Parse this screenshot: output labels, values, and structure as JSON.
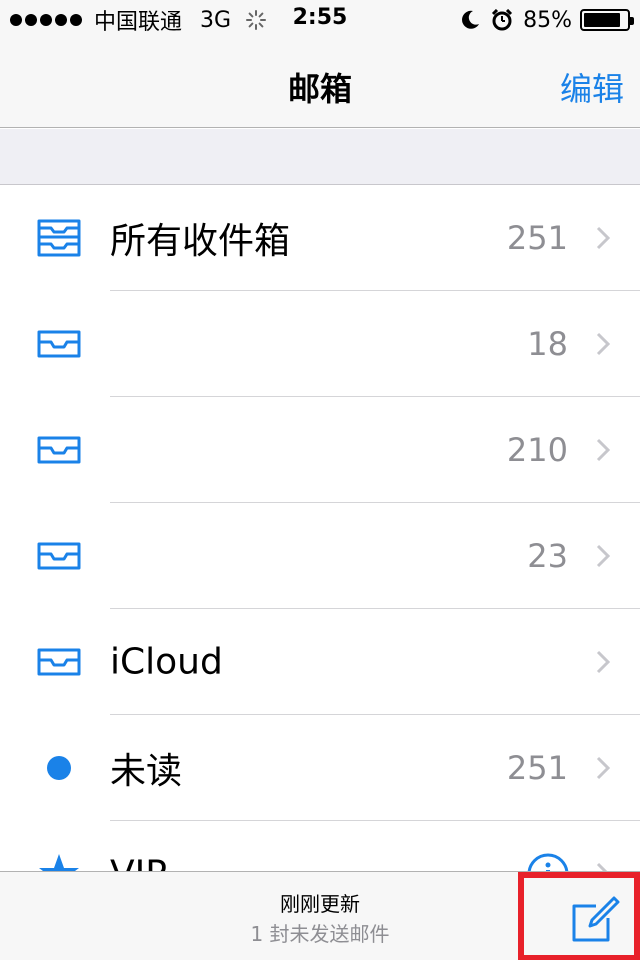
{
  "status_bar": {
    "carrier": "中国联通",
    "network": "3G",
    "time": "2:55",
    "battery": "85%",
    "battery_level": 0.85
  },
  "nav": {
    "title": "邮箱",
    "edit_label": "编辑"
  },
  "mailboxes": [
    {
      "label": "所有收件箱",
      "count": "251",
      "icon": "tray-stack-icon"
    },
    {
      "label": "",
      "count": "18",
      "icon": "tray-icon"
    },
    {
      "label": "",
      "count": "210",
      "icon": "tray-icon"
    },
    {
      "label": "",
      "count": "23",
      "icon": "tray-icon"
    },
    {
      "label": "iCloud",
      "count": "",
      "icon": "tray-icon"
    },
    {
      "label": "未读",
      "count": "251",
      "icon": "blue-dot-icon"
    },
    {
      "label": "VIP",
      "count": "",
      "icon": "star-icon"
    }
  ],
  "toolbar": {
    "status": "刚刚更新",
    "sub_status": "1 封未发送邮件"
  },
  "colors": {
    "accent": "#1a82e8",
    "highlight": "#e8212a"
  }
}
